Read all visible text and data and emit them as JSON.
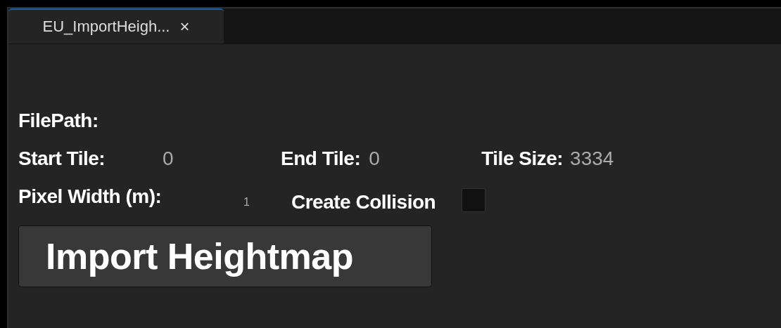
{
  "tabs": [
    {
      "label": "EU_ImportHeigh...",
      "close": "×",
      "selected": true
    }
  ],
  "file_path": {
    "label": "FilePath:"
  },
  "start_tile": {
    "label": "Start Tile:",
    "value": "0"
  },
  "end_tile": {
    "label": "End Tile:",
    "value": "0"
  },
  "tile_size": {
    "label": "Tile Size:",
    "value": "3334"
  },
  "pixel_width": {
    "label": "Pixel Width (m):",
    "value": "1"
  },
  "create_collision": {
    "label": "Create Collision",
    "checked": false
  },
  "buttons": [
    "Import Heightmap"
  ]
}
